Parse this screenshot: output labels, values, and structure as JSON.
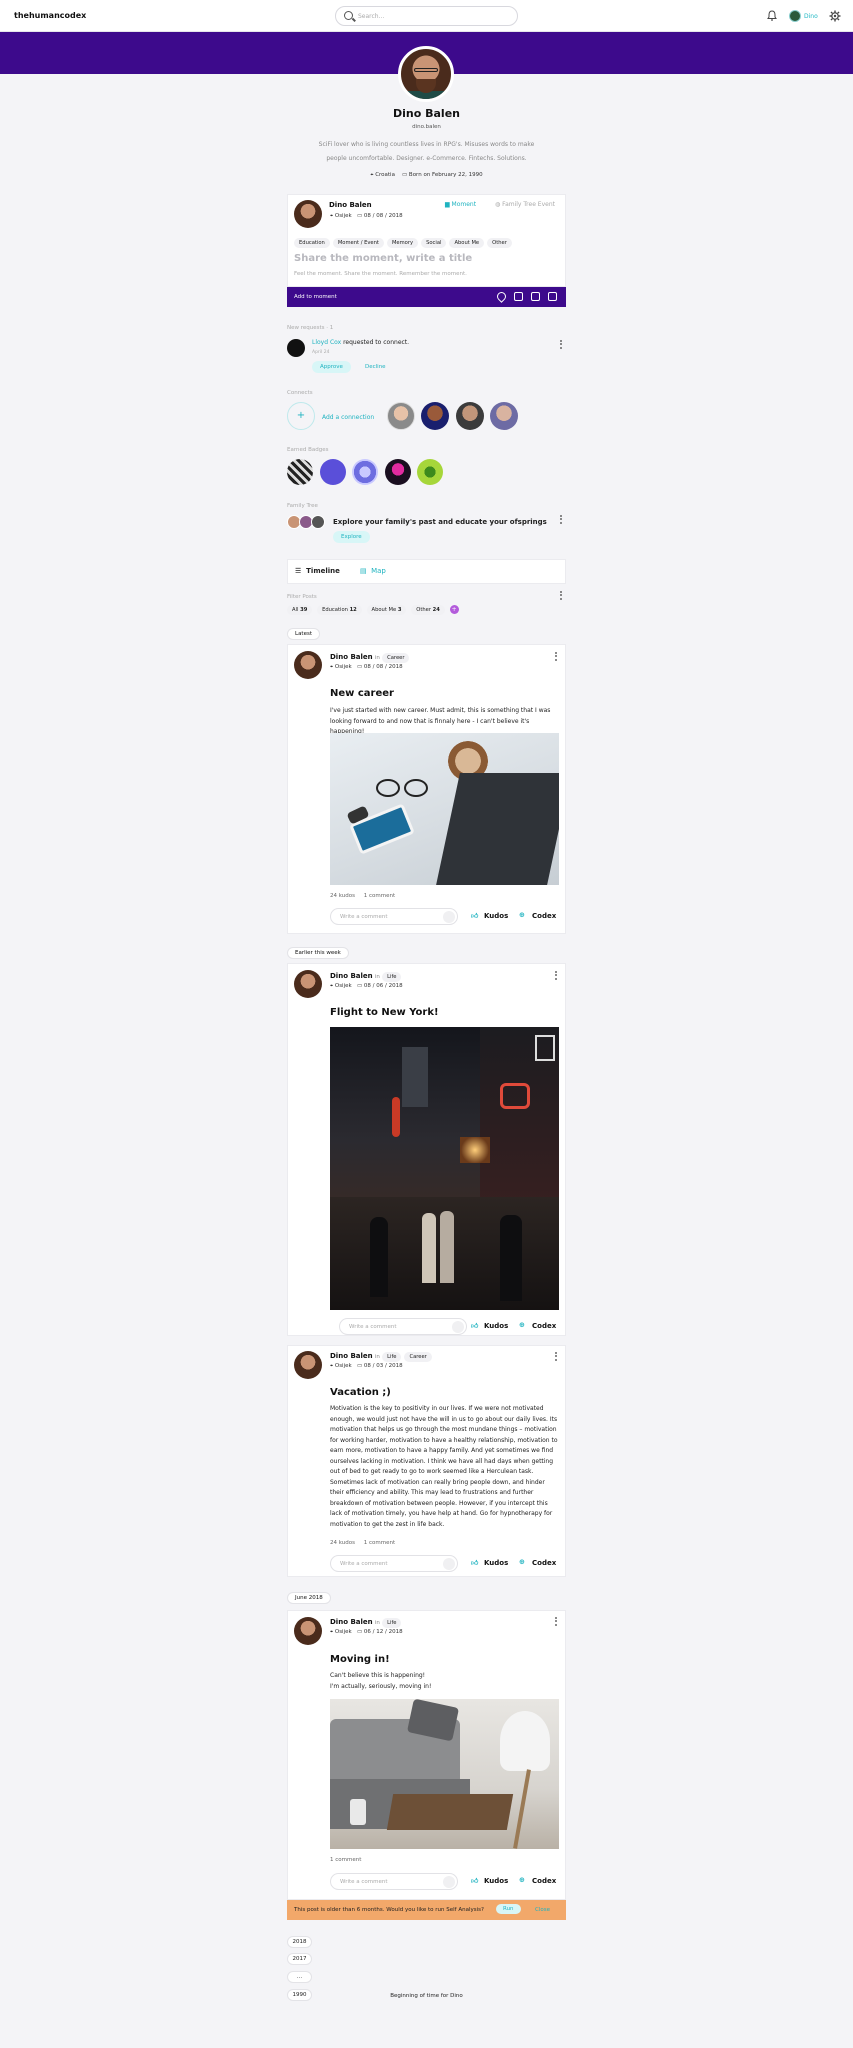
{
  "nav": {
    "brand": "thehumancodex",
    "search_placeholder": "Search...",
    "user_name": "Dino"
  },
  "profile": {
    "name": "Dino Balen",
    "handle": "dino.balen",
    "bio_line1": "SciFi lover who is living countless lives in RPG's. Misuses words to make",
    "bio_line2": "people uncomfortable. Designer. e-Commerce. Fintechs. Solutions.",
    "location": "Croatia",
    "born": "Born on February 22, 1990"
  },
  "composer": {
    "name": "Dino Balen",
    "location": "Osijek",
    "date": "08 / 08 / 2018",
    "mode_moment": "Moment",
    "mode_family": "Family Tree Event",
    "tags": [
      "Education",
      "Moment / Event",
      "Memory",
      "Social",
      "About Me",
      "Other"
    ],
    "title_placeholder": "Share the moment, write a title",
    "body_placeholder": "Feel the moment. Share the moment. Remember the moment.",
    "add_label": "Add to moment"
  },
  "requests": {
    "label": "New requests · 1",
    "requester": "Lloyd Cox",
    "text": " requested to connect.",
    "date": "April 24",
    "approve": "Approve",
    "decline": "Decline"
  },
  "connects": {
    "label": "Connects",
    "add_label": "Add a connection"
  },
  "badges": {
    "label": "Earned Badges"
  },
  "family_tree": {
    "label": "Family Tree",
    "text": "Explore your family's past and educate your ofsprings",
    "button": "Explore"
  },
  "view_tabs": {
    "timeline": "Timeline",
    "map": "Map"
  },
  "filters": {
    "label": "Filter Posts",
    "items": [
      {
        "name": "All",
        "count": "39"
      },
      {
        "name": "Education",
        "count": "12"
      },
      {
        "name": "About Me",
        "count": "3"
      },
      {
        "name": "Other",
        "count": "24"
      }
    ]
  },
  "date_labels": {
    "latest": "Latest",
    "earlier": "Earlier this week",
    "june": "June 2018"
  },
  "posts": [
    {
      "name": "Dino Balen",
      "in": "in",
      "tags": [
        "Career"
      ],
      "location": "Osijek",
      "date": "08 / 08 / 2018",
      "title": "New career",
      "body": "I've just started with new career. Must admit, this is something that I was looking forward to and now that is finnaly here - I can't believe it's happening!",
      "kudos": "24 kudos",
      "comments": "1 comment"
    },
    {
      "name": "Dino Balen",
      "in": "in",
      "tags": [
        "Life"
      ],
      "location": "Osijek",
      "date": "08 / 06 / 2018",
      "title": "Flight to New York!"
    },
    {
      "name": "Dino Balen",
      "in": "in",
      "tags": [
        "Life",
        "Career"
      ],
      "location": "Osijek",
      "date": "08 / 03 / 2018",
      "title": "Vacation ;)",
      "body": "Motivation is the key to positivity in our lives. If we were not motivated enough, we would just not have the will in us to go about our daily lives. Its motivation that helps us go through the most mundane things – motivation for working harder, motivation to have a healthy relationship, motivation to earn more, motivation to have a happy family. And yet sometimes we find ourselves lacking in motivation. I think we have all had days when getting out of bed to get ready to go to work seemed like a Herculean task. Sometimes lack of motivation can really bring people down, and hinder their efficiency and ability. This may lead to frustrations and further breakdown of motivation between people. However, if you intercept this lack of motivation timely, you have help at hand. Go for hypnotherapy for motivation to get the zest in life back.",
      "kudos": "24 kudos",
      "comments": "1 comment"
    },
    {
      "name": "Dino Balen",
      "in": "in",
      "tags": [
        "Life"
      ],
      "location": "Osijek",
      "date": "06 / 12 / 2018",
      "title": "Moving in!",
      "body1": "Can't believe this is happening!",
      "body2": "I'm actually, seriously, moving in!",
      "comments": "1 comment"
    }
  ],
  "comment_placeholder": "Write a comment",
  "kudos_label": "Kudos",
  "codex_label": "Codex",
  "self_analysis": {
    "text": "This post is older than 6 months. Would you like to run Self Analysis?",
    "run": "Run",
    "close": "Close"
  },
  "years": [
    "2018",
    "2017",
    "...",
    "1990"
  ],
  "beginning": "Beginning of time for Dino"
}
